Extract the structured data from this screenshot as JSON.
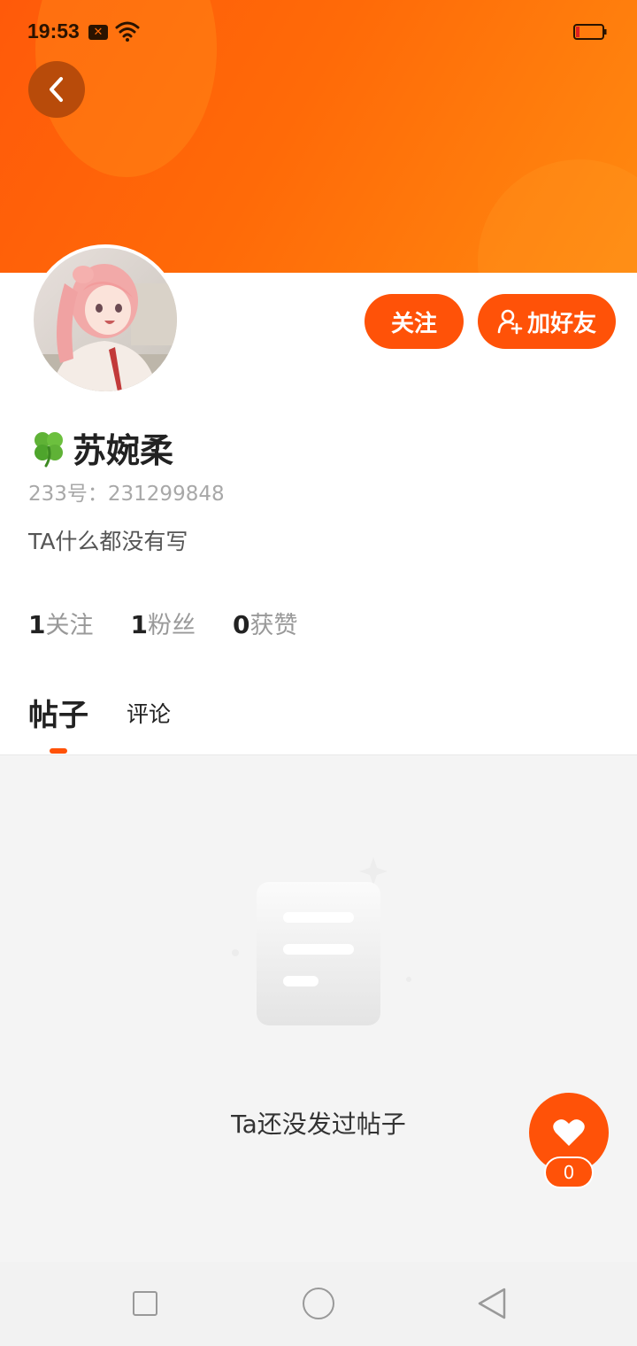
{
  "status_bar": {
    "time": "19:53",
    "sim_icon": "sim-card-x-icon",
    "wifi_icon": "wifi-icon",
    "battery_icon": "battery-low-icon"
  },
  "header": {
    "back_icon": "chevron-left-icon",
    "accent": "#ff5208"
  },
  "profile": {
    "name": "苏婉柔",
    "name_prefix_icon": "four-leaf-clover-icon",
    "id_text": "233号：231299848",
    "bio": "TA什么都没有写",
    "follow_label": "关注",
    "add_friend_label": "加好友",
    "add_friend_icon": "add-user-icon"
  },
  "stats": [
    {
      "value": "1",
      "label": "关注"
    },
    {
      "value": "1",
      "label": "粉丝"
    },
    {
      "value": "0",
      "label": "获赞"
    }
  ],
  "tabs": {
    "posts": "帖子",
    "comments": "评论",
    "active": "posts"
  },
  "empty_state": {
    "icon": "document-icon",
    "text": "Ta还没发过帖子"
  },
  "like_fab": {
    "icon": "heart-icon",
    "count": "0"
  },
  "nav_bar": {
    "recents_icon": "square-icon",
    "home_icon": "circle-icon",
    "back_icon": "triangle-back-icon"
  }
}
